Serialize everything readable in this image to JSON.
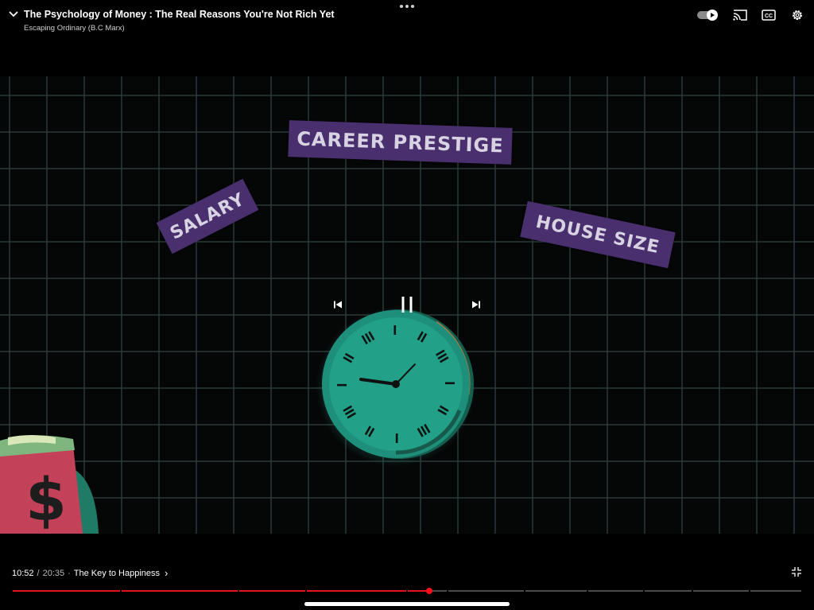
{
  "header": {
    "title": "The Psychology of Money : The Real Reasons You're Not Rich Yet",
    "channel": "Escaping Ordinary (B.C Marx)",
    "icons": {
      "collapse": "chevron-down-icon",
      "more": "more-horizontal-icon",
      "autoplay": "autoplay-toggle-icon",
      "cast": "cast-icon",
      "captions": "closed-captions-icon",
      "settings": "gear-icon"
    },
    "captions_label": "CC"
  },
  "video": {
    "labels": {
      "career": "CAREER PRESTIGE",
      "salary": "SALARY",
      "house": "HOUSE SIZE"
    },
    "money_symbol": "$",
    "colors": {
      "card": "#4a2f6e",
      "card_text": "#d8d3e2",
      "grid": "#2a3a38",
      "clock_face": "#1f9c86",
      "clock_glow": "#37d6bb"
    }
  },
  "controls": {
    "previous": "skip-previous-icon",
    "pause": "pause-icon",
    "next": "skip-next-icon"
  },
  "footer": {
    "current_time": "10:52",
    "separator": "/",
    "duration": "20:35",
    "chapter_dot": "·",
    "chapter": "The Key to Happiness",
    "chapter_chevron": "›",
    "fullscreen": "exit-fullscreen-icon",
    "progress_fraction": 0.528,
    "accent_color": "#e8131c"
  }
}
